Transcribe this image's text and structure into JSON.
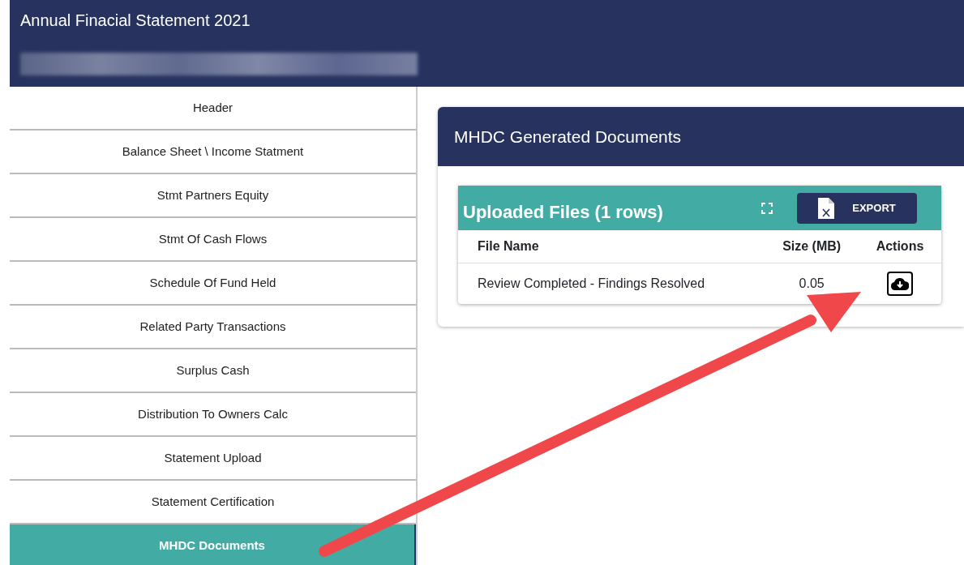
{
  "header": {
    "title": "Annual Finacial Statement 2021"
  },
  "sidebar": {
    "items": [
      {
        "label": "Header",
        "selected": false
      },
      {
        "label": "Balance Sheet \\ Income Statment",
        "selected": false
      },
      {
        "label": "Stmt Partners Equity",
        "selected": false
      },
      {
        "label": "Stmt Of Cash Flows",
        "selected": false
      },
      {
        "label": "Schedule Of Fund Held",
        "selected": false
      },
      {
        "label": "Related Party Transactions",
        "selected": false
      },
      {
        "label": "Surplus Cash",
        "selected": false
      },
      {
        "label": "Distribution To Owners Calc",
        "selected": false
      },
      {
        "label": "Statement Upload",
        "selected": false
      },
      {
        "label": "Statement Certification",
        "selected": false
      },
      {
        "label": "MHDC Documents",
        "selected": true
      }
    ]
  },
  "panel": {
    "title": "MHDC Generated Documents",
    "files": {
      "title": "Uploaded Files (1 rows)",
      "export_label": "EXPORT",
      "columns": [
        "File Name",
        "Size (MB)",
        "Actions"
      ],
      "rows": [
        {
          "file_name": "Review Completed - Findings Resolved",
          "size": "0.05"
        }
      ]
    }
  }
}
